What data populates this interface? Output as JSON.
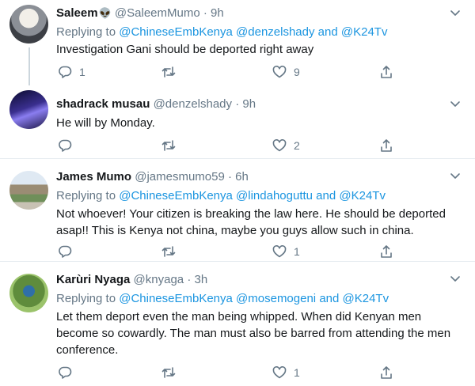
{
  "tweets": [
    {
      "name": "Saleem",
      "name_emoji": "👽",
      "handle": "@SaleemMumo",
      "dot": "·",
      "time": "9h",
      "replying_prefix": "Replying to",
      "replying_to": [
        "@ChineseEmbKenya",
        "@denzelshady"
      ],
      "replying_and": "and",
      "replying_last": "@K24Tv",
      "text": "Investigation Gani should be deported right away",
      "replies": "1",
      "retweets": "",
      "likes": "9"
    },
    {
      "name": "shadrack musau",
      "handle": "@denzelshady",
      "dot": "·",
      "time": "9h",
      "text": "He will by Monday.",
      "replies": "",
      "retweets": "",
      "likes": "2"
    },
    {
      "name": "James Mumo",
      "handle": "@jamesmumo59",
      "dot": "·",
      "time": "6h",
      "replying_prefix": "Replying to",
      "replying_to": [
        "@ChineseEmbKenya",
        "@lindahoguttu"
      ],
      "replying_and": "and",
      "replying_last": "@K24Tv",
      "text": "Not whoever! Your citizen is breaking the law here. He should be deported asap!! This is Kenya not china, maybe you guys allow such in china.",
      "replies": "",
      "retweets": "",
      "likes": "1"
    },
    {
      "name": "Karùri Nyaga",
      "handle": "@knyaga",
      "dot": "·",
      "time": "3h",
      "replying_prefix": "Replying to",
      "replying_to": [
        "@ChineseEmbKenya",
        "@mosemogeni"
      ],
      "replying_and": "and",
      "replying_last": "@K24Tv",
      "text": "Let them deport even the man being whipped. When did Kenyan men become so cowardly. The man must also be barred from attending the men conference.",
      "replies": "",
      "retweets": "",
      "likes": "1"
    }
  ],
  "icons": {
    "reply": "reply-icon",
    "retweet": "retweet-icon",
    "like": "heart-icon",
    "share": "share-icon",
    "more": "chevron-down-icon"
  },
  "colors": {
    "link": "#1b95e0",
    "secondary_text": "#657786",
    "divider": "#e6ecf0",
    "thread_line": "#ccd6dd"
  }
}
